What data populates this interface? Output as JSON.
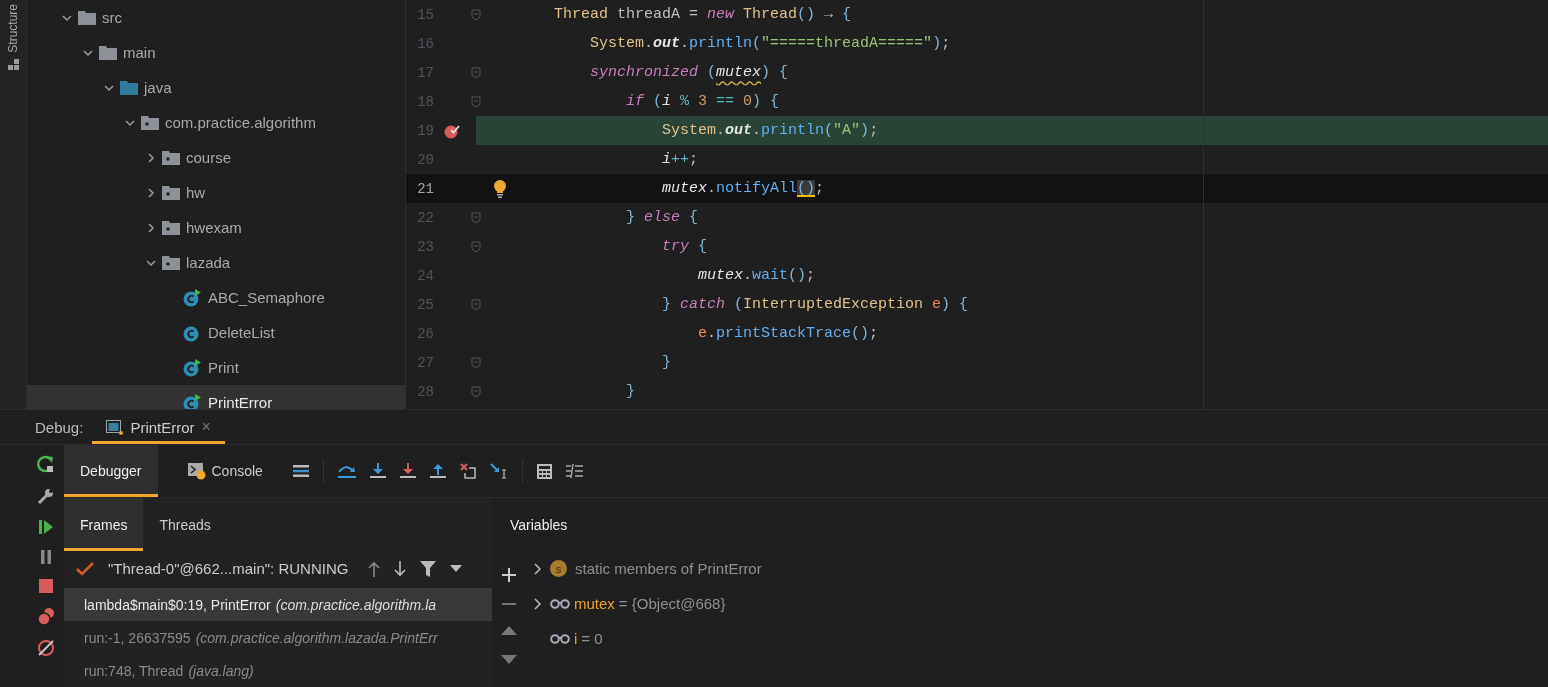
{
  "left_strip": {
    "label": "Structure"
  },
  "project_tree": [
    {
      "label": "src",
      "kind": "folder",
      "expanded": true,
      "selected": false,
      "children": [
        {
          "label": "main",
          "kind": "folder",
          "expanded": true,
          "selected": false,
          "children": [
            {
              "label": "java",
              "kind": "source-folder",
              "expanded": true,
              "selected": false,
              "children": [
                {
                  "label": "com.practice.algorithm",
                  "kind": "package",
                  "expanded": true,
                  "selected": false,
                  "children": [
                    {
                      "label": "course",
                      "kind": "package",
                      "expanded": false,
                      "selected": false
                    },
                    {
                      "label": "hw",
                      "kind": "package",
                      "expanded": false,
                      "selected": false
                    },
                    {
                      "label": "hwexam",
                      "kind": "package",
                      "expanded": false,
                      "selected": false
                    },
                    {
                      "label": "lazada",
                      "kind": "package",
                      "expanded": true,
                      "selected": false,
                      "children": [
                        {
                          "label": "ABC_Semaphore",
                          "kind": "class",
                          "runnable": true,
                          "selected": false
                        },
                        {
                          "label": "DeleteList",
                          "kind": "class",
                          "runnable": false,
                          "selected": false
                        },
                        {
                          "label": "Print",
                          "kind": "class",
                          "runnable": true,
                          "selected": false
                        },
                        {
                          "label": "PrintError",
                          "kind": "class",
                          "runnable": true,
                          "selected": true
                        }
                      ]
                    }
                  ]
                }
              ]
            }
          ]
        }
      ]
    }
  ],
  "editor": {
    "lines": [
      {
        "number": "15",
        "fold": true,
        "breakpoint": false,
        "bulb": false,
        "current": false,
        "caret": false,
        "tokens": [
          {
            "kind": "type",
            "text": "Thread"
          },
          {
            "kind": "plain",
            "text": " threadA = "
          },
          {
            "kind": "kw",
            "text": "new "
          },
          {
            "kind": "type",
            "text": "Thread"
          },
          {
            "kind": "brace",
            "text": "()"
          },
          {
            "kind": "plain",
            "text": " → "
          },
          {
            "kind": "brace",
            "text": "{"
          }
        ],
        "children": [
          {
            "number": "16",
            "fold": false,
            "breakpoint": false,
            "bulb": false,
            "current": false,
            "caret": false,
            "tokens": [
              {
                "kind": "type",
                "text": "System"
              },
              {
                "kind": "plain",
                "text": "."
              },
              {
                "kind": "static",
                "text": "out"
              },
              {
                "kind": "plain",
                "text": "."
              },
              {
                "kind": "method",
                "text": "println"
              },
              {
                "kind": "brace",
                "text": "("
              },
              {
                "kind": "string",
                "text": "\"=====threadA=====\""
              },
              {
                "kind": "brace",
                "text": ")"
              },
              {
                "kind": "plain",
                "text": ";"
              }
            ]
          },
          {
            "number": "17",
            "fold": true,
            "breakpoint": false,
            "bulb": false,
            "current": false,
            "caret": false,
            "tokens": [
              {
                "kind": "kw",
                "text": "synchronized "
              },
              {
                "kind": "brace",
                "text": "("
              },
              {
                "kind": "field",
                "text": "mutex",
                "warning": true
              },
              {
                "kind": "brace",
                "text": ") {"
              }
            ],
            "children": [
              {
                "number": "18",
                "fold": true,
                "breakpoint": false,
                "bulb": false,
                "current": false,
                "caret": false,
                "tokens": [
                  {
                    "kind": "kw",
                    "text": "if "
                  },
                  {
                    "kind": "brace",
                    "text": "("
                  },
                  {
                    "kind": "field",
                    "text": "i"
                  },
                  {
                    "kind": "op",
                    "text": " % "
                  },
                  {
                    "kind": "num",
                    "text": "3"
                  },
                  {
                    "kind": "op",
                    "text": " == "
                  },
                  {
                    "kind": "num",
                    "text": "0"
                  },
                  {
                    "kind": "brace",
                    "text": ") {"
                  }
                ],
                "children": [
                  {
                    "number": "19",
                    "fold": false,
                    "breakpoint": true,
                    "bulb": false,
                    "current": true,
                    "caret": false,
                    "tokens": [
                      {
                        "kind": "type",
                        "text": "System"
                      },
                      {
                        "kind": "plain",
                        "text": "."
                      },
                      {
                        "kind": "static",
                        "text": "out"
                      },
                      {
                        "kind": "plain",
                        "text": "."
                      },
                      {
                        "kind": "method",
                        "text": "println"
                      },
                      {
                        "kind": "brace",
                        "text": "("
                      },
                      {
                        "kind": "string",
                        "text": "\"A\""
                      },
                      {
                        "kind": "brace",
                        "text": ")"
                      },
                      {
                        "kind": "plain",
                        "text": ";"
                      }
                    ]
                  },
                  {
                    "number": "20",
                    "fold": false,
                    "breakpoint": false,
                    "bulb": false,
                    "current": false,
                    "caret": false,
                    "tokens": [
                      {
                        "kind": "field",
                        "text": "i"
                      },
                      {
                        "kind": "op",
                        "text": "++"
                      },
                      {
                        "kind": "plain",
                        "text": ";"
                      }
                    ]
                  },
                  {
                    "number": "21",
                    "fold": false,
                    "breakpoint": false,
                    "bulb": true,
                    "current": false,
                    "caret": true,
                    "tokens": [
                      {
                        "kind": "field",
                        "text": "mutex"
                      },
                      {
                        "kind": "plain",
                        "text": "."
                      },
                      {
                        "kind": "method",
                        "text": "notifyAll"
                      },
                      {
                        "kind": "brace",
                        "text": "()",
                        "matched": true
                      },
                      {
                        "kind": "plain",
                        "text": ";"
                      }
                    ]
                  }
                ]
              },
              {
                "number": "22",
                "fold": true,
                "breakpoint": false,
                "bulb": false,
                "current": false,
                "caret": false,
                "tokens": [
                  {
                    "kind": "brace",
                    "text": "} "
                  },
                  {
                    "kind": "kw",
                    "text": "else "
                  },
                  {
                    "kind": "brace",
                    "text": "{"
                  }
                ],
                "children": [
                  {
                    "number": "23",
                    "fold": true,
                    "breakpoint": false,
                    "bulb": false,
                    "current": false,
                    "caret": false,
                    "tokens": [
                      {
                        "kind": "kw",
                        "text": "try "
                      },
                      {
                        "kind": "brace",
                        "text": "{"
                      }
                    ],
                    "children": [
                      {
                        "number": "24",
                        "fold": false,
                        "breakpoint": false,
                        "bulb": false,
                        "current": false,
                        "caret": false,
                        "tokens": [
                          {
                            "kind": "field",
                            "text": "mutex"
                          },
                          {
                            "kind": "plain",
                            "text": "."
                          },
                          {
                            "kind": "method",
                            "text": "wait"
                          },
                          {
                            "kind": "brace",
                            "text": "()"
                          },
                          {
                            "kind": "plain",
                            "text": ";"
                          }
                        ]
                      }
                    ]
                  },
                  {
                    "number": "25",
                    "fold": true,
                    "breakpoint": false,
                    "bulb": false,
                    "current": false,
                    "caret": false,
                    "tokens": [
                      {
                        "kind": "brace",
                        "text": "} "
                      },
                      {
                        "kind": "kw",
                        "text": "catch "
                      },
                      {
                        "kind": "brace",
                        "text": "("
                      },
                      {
                        "kind": "type",
                        "text": "InterruptedException "
                      },
                      {
                        "kind": "param",
                        "text": "e"
                      },
                      {
                        "kind": "brace",
                        "text": ") {"
                      }
                    ],
                    "children": [
                      {
                        "number": "26",
                        "fold": false,
                        "breakpoint": false,
                        "bulb": false,
                        "current": false,
                        "caret": false,
                        "tokens": [
                          {
                            "kind": "param",
                            "text": "e"
                          },
                          {
                            "kind": "plain",
                            "text": "."
                          },
                          {
                            "kind": "method",
                            "text": "printStackTrace"
                          },
                          {
                            "kind": "brace",
                            "text": "()"
                          },
                          {
                            "kind": "plain",
                            "text": ";"
                          }
                        ]
                      }
                    ]
                  },
                  {
                    "number": "27",
                    "fold": true,
                    "breakpoint": false,
                    "bulb": false,
                    "current": false,
                    "caret": false,
                    "tokens": [
                      {
                        "kind": "brace",
                        "text": "}"
                      }
                    ]
                  }
                ]
              },
              {
                "number": "28",
                "fold": true,
                "breakpoint": false,
                "bulb": false,
                "current": false,
                "caret": false,
                "tokens": [
                  {
                    "kind": "brace",
                    "text": "}"
                  }
                ]
              }
            ]
          }
        ]
      }
    ]
  },
  "debug": {
    "label": "Debug:",
    "session_tab": {
      "label": "PrintError",
      "close": "×"
    },
    "tabs": [
      {
        "label": "Debugger",
        "selected": true
      },
      {
        "label": "Console",
        "selected": false
      }
    ],
    "frames_tabs": [
      {
        "label": "Frames",
        "selected": true
      },
      {
        "label": "Threads",
        "selected": false
      }
    ],
    "thread": "\"Thread-0\"@662...main\": RUNNING",
    "frames": [
      {
        "method": "lambda$main$0:19, PrintError",
        "location": "(com.practice.algorithm.la",
        "selected": true
      },
      {
        "method": "run:-1, 26637595",
        "location": "(com.practice.algorithm.lazada.PrintErr",
        "selected": false
      },
      {
        "method": "run:748, Thread",
        "location": "(java.lang)",
        "selected": false
      }
    ],
    "variables_title": "Variables",
    "variables": [
      {
        "kind": "static",
        "badge": "s",
        "name": "static members of PrintError",
        "expandable": true
      },
      {
        "kind": "field",
        "name": "mutex",
        "value": "= {Object@668}",
        "expandable": true
      },
      {
        "kind": "field",
        "name": "i",
        "value": "= 0",
        "expandable": false
      }
    ]
  }
}
